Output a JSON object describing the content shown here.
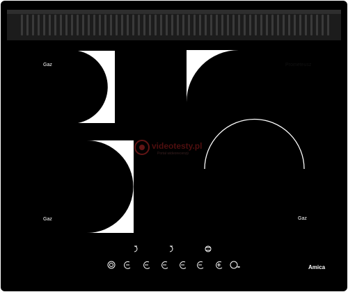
{
  "cooktop": {
    "zones": [
      {
        "id": "top-left",
        "label": "Gaz"
      },
      {
        "id": "bottom-left",
        "label": "Gaz"
      },
      {
        "id": "right-upper",
        "label": "Prometeusz"
      },
      {
        "id": "right-lower",
        "label": "Gaz"
      }
    ],
    "brand": "Amica"
  },
  "watermark": {
    "text": "videotesty.pl",
    "sub": "Portal wideorecenzji"
  },
  "colors": {
    "glass": "#000000",
    "vent": "#1a1a1a",
    "zone_fill": "#ffffff",
    "control_line": "#ffffff",
    "watermark": "#7a1a1a"
  },
  "controls": {
    "top_row_icons": [
      "timer-icon",
      "timer-icon",
      "lock-icon"
    ],
    "bottom_row_icons": [
      "power-icon",
      "zone-select-icon",
      "minus-icon",
      "zone-select-icon",
      "zone-select-icon",
      "zone-select-icon",
      "plus-icon",
      "key-lock-icon"
    ]
  }
}
